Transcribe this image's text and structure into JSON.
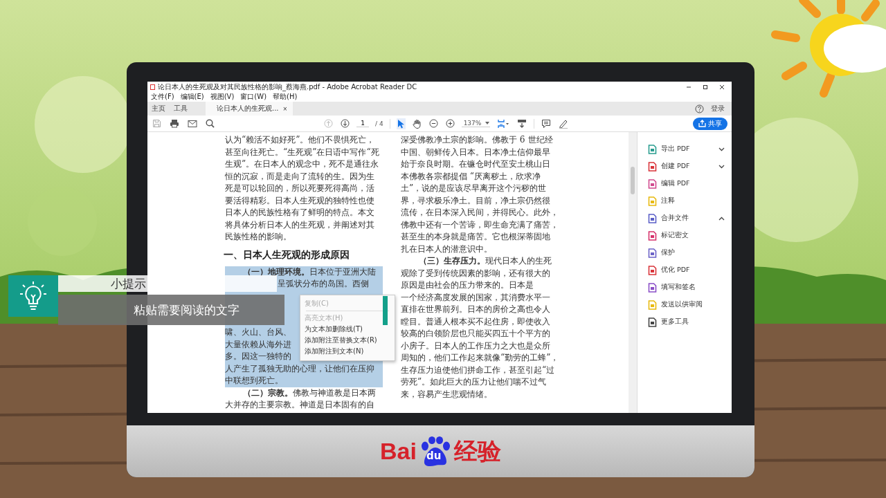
{
  "window": {
    "title": "论日本人的生死观及对其民族性格的影响_蔡海燕.pdf - Adobe Acrobat Reader DC"
  },
  "menu": [
    "文件(F)",
    "编辑(E)",
    "视图(V)",
    "窗口(W)",
    "帮助(H)"
  ],
  "tabs": [
    {
      "label": "主页",
      "selected": false
    },
    {
      "label": "工具",
      "selected": false
    },
    {
      "label": "论日本人的生死观...",
      "selected": true,
      "close": "×"
    }
  ],
  "account": {
    "login": "登录"
  },
  "toolbar": {
    "tools": [
      {
        "kind": "select",
        "selected": true
      },
      {
        "kind": "hand",
        "selected": false
      }
    ],
    "page": "1",
    "pages": "/ 4",
    "zoom": "137%",
    "share": "共享"
  },
  "document": {
    "left_column": [
      {
        "kind": "line",
        "text": "认为“赖活不如好死”。他们不畏惧死亡，",
        "selected": false
      },
      {
        "kind": "line",
        "text": "甚至向往死亡。“生死观”在日语中写作“死",
        "selected": false
      },
      {
        "kind": "line",
        "text": "生观”。在日本人的观念中，死不是通往永",
        "selected": false
      },
      {
        "kind": "line",
        "text": "恒的沉寂，而是走向了流转的生。因为生",
        "selected": false
      },
      {
        "kind": "line",
        "text": "死是可以轮回的，所以死要死得高尚，活",
        "selected": false
      },
      {
        "kind": "line",
        "text": "要活得精彩。日本人生死观的独特性也使",
        "selected": false
      },
      {
        "kind": "line",
        "text": "日本人的民族性格有了鲜明的特点。本文",
        "selected": false
      },
      {
        "kind": "line",
        "text": "将具体分析日本人的生死观，并阐述对其",
        "selected": false
      },
      {
        "kind": "line",
        "text": "民族性格的影响。",
        "selected": false
      },
      {
        "kind": "heading",
        "text": "一、日本人生死观的形成原因"
      },
      {
        "kind": "first",
        "text": "**（一）地理环境。**日本位于亚洲大陆",
        "selected": true
      },
      {
        "kind": "tail",
        "text": "呈弧状分布的岛国。西侧",
        "selected": true
      },
      {
        "kind": "covered",
        "selected": true
      },
      {
        "kind": "covered",
        "selected": true
      },
      {
        "kind": "covered",
        "selected": true
      },
      {
        "kind": "line",
        "text": "啸、火山、台风、",
        "selected": true
      },
      {
        "kind": "line",
        "text": "大量依赖从海外进",
        "selected": true
      },
      {
        "kind": "line",
        "text": "多。因这一独特的",
        "selected": true
      },
      {
        "kind": "line",
        "text": "人产生了孤独无助的心理，让他们在压抑",
        "selected": true
      },
      {
        "kind": "line",
        "text": "中联想到死亡。",
        "selected": true
      },
      {
        "kind": "first",
        "text": "**（二）宗教。**佛教与神道教是日本两",
        "selected": false
      },
      {
        "kind": "line",
        "text": "大并存的主要宗教。神道是日本固有的自",
        "selected": false
      }
    ],
    "right_column": [
      {
        "kind": "line",
        "text": "深受佛教净土宗的影响。佛教于 6 世纪经"
      },
      {
        "kind": "line",
        "text": "中国、朝鲜传入日本。日本净土信仰最早"
      },
      {
        "kind": "line",
        "text": "始于奈良时期。在镰仓时代至安土桃山日"
      },
      {
        "kind": "line",
        "text": "本佛教各宗都提倡 “厌离秽土，欣求净"
      },
      {
        "kind": "line",
        "text": "土”，说的是应该尽早离开这个污秽的世"
      },
      {
        "kind": "line",
        "text": "界，寻求极乐净土。目前，净土宗仍然很"
      },
      {
        "kind": "line",
        "text": "流传，在日本深入民间，并得民心。此外，"
      },
      {
        "kind": "line",
        "text": "佛教中还有一个苦谛，即生命充满了痛苦，"
      },
      {
        "kind": "line",
        "text": "甚至生的本身就是痛苦。它也根深蒂固地"
      },
      {
        "kind": "line",
        "text": "扎在日本人的潜意识中。"
      },
      {
        "kind": "first",
        "text": "**（三）生存压力。**现代日本人的生死"
      },
      {
        "kind": "line",
        "text": "观除了受到传统因素的影响，还有很大的"
      },
      {
        "kind": "line",
        "text": "原因是由社会的压力带来的。日本是"
      },
      {
        "kind": "line",
        "text": "一个经济高度发展的国家，其消费水平一"
      },
      {
        "kind": "line",
        "text": "直排在世界前列。日本的房价之高也令人"
      },
      {
        "kind": "line",
        "text": "瞠目。普通人根本买不起住房，即使收入"
      },
      {
        "kind": "line",
        "text": "较高的白领阶层也只能买四五十个平方的"
      },
      {
        "kind": "line",
        "text": "小房子。日本人的工作压力之大也是众所"
      },
      {
        "kind": "line",
        "text": "周知的，他们工作起来就像“勤劳的工蜂”，"
      },
      {
        "kind": "line",
        "text": "生存压力迫使他们拼命工作，甚至引起“过"
      },
      {
        "kind": "line",
        "text": "劳死”。如此巨大的压力让他们喘不过气"
      },
      {
        "kind": "line",
        "text": "来，容易产生悲观情绪。"
      }
    ]
  },
  "context_menu": [
    {
      "label": "复制(C)",
      "disabled": true
    },
    {
      "label": "高亮文本(H)",
      "disabled": true
    },
    {
      "label": "为文本加删除线(T)",
      "disabled": false
    },
    {
      "label": "添加附注至替换文本(R)",
      "disabled": false
    },
    {
      "label": "添加附注到文本(N)",
      "disabled": false
    }
  ],
  "tools_pane": [
    {
      "label": "导出 PDF",
      "color": "#2a9d8f",
      "expanded": false
    },
    {
      "label": "创建 PDF",
      "color": "#d9343a",
      "expanded": false
    },
    {
      "label": "编辑 PDF",
      "color": "#d14b8f"
    },
    {
      "label": "注释",
      "color": "#e8b90f"
    },
    {
      "label": "合并文件",
      "color": "#5b5fc7",
      "expanded": true
    },
    {
      "label": "标记密文",
      "color": "#d6336c"
    },
    {
      "label": "保护",
      "color": "#6c63c7"
    },
    {
      "label": "优化 PDF",
      "color": "#d9343a"
    },
    {
      "label": "填写和签名",
      "color": "#8b4fc7"
    },
    {
      "label": "发送以供审阅",
      "color": "#e8b90f"
    },
    {
      "label": "更多工具",
      "color": "#444444"
    }
  ],
  "tip": {
    "title": "小提示",
    "text": "粘贴需要阅读的文字"
  },
  "brand": {
    "left": "Bai",
    "middle": "du",
    "right": "经验"
  }
}
